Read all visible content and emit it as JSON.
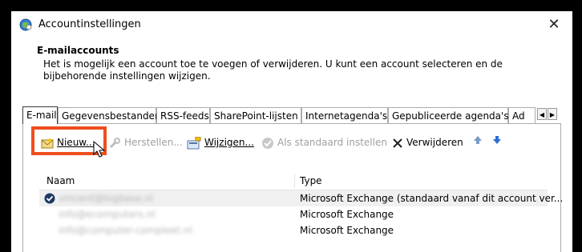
{
  "window": {
    "title": "Accountinstellingen",
    "close_glyph": "✕",
    "icon": "account-settings-icon"
  },
  "section": {
    "title": "E-mailaccounts",
    "description": "Het is mogelijk een account toe te voegen of verwijderen. U kunt een account selecteren en de bijbehorende instellingen wijzigen."
  },
  "tabs": [
    {
      "label": "E-mail",
      "active": true
    },
    {
      "label": "Gegevensbestanden"
    },
    {
      "label": "RSS-feeds"
    },
    {
      "label": "SharePoint-lijsten"
    },
    {
      "label": "Internetagenda's"
    },
    {
      "label": "Gepubliceerde agenda's"
    },
    {
      "label": "Ad"
    }
  ],
  "toolbar": {
    "new_label": "Nieuw...",
    "repair_label": "Herstellen...",
    "change_label": "Wijzigen...",
    "default_label": "Als standaard instellen",
    "remove_label": "Verwijderen"
  },
  "list": {
    "col_name": "Naam",
    "col_type": "Type",
    "rows": [
      {
        "name": "vincent@bigbase.nl",
        "type": "Microsoft Exchange (standaard vanaf dit account ver...",
        "default": true
      },
      {
        "name": "info@ecomputers.nl",
        "type": "Microsoft Exchange"
      },
      {
        "name": "info@computer-compleet.nl",
        "type": "Microsoft Exchange"
      }
    ]
  },
  "colors": {
    "highlight_border": "#f04e1e",
    "selected_row": "#f0f0f0",
    "arrow_up": "#7a9cc6",
    "arrow_down": "#2b6fd6"
  }
}
